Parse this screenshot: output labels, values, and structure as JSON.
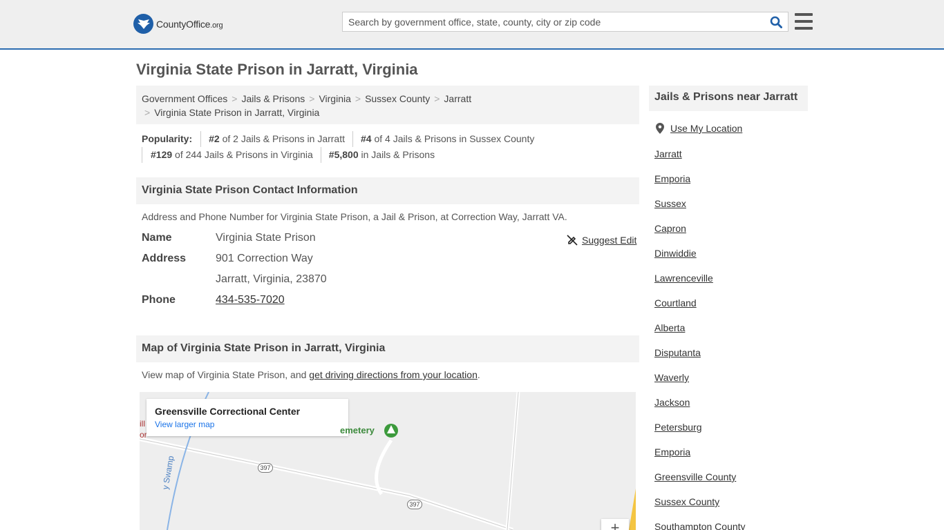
{
  "header": {
    "logo_name": "CountyOffice",
    "logo_tld": ".org",
    "search_placeholder": "Search by government office, state, county, city or zip code"
  },
  "page_title": "Virginia State Prison in Jarratt, Virginia",
  "breadcrumb": [
    "Government Offices",
    "Jails & Prisons",
    "Virginia",
    "Sussex County",
    "Jarratt",
    "Virginia State Prison in Jarratt, Virginia"
  ],
  "popularity": {
    "label": "Popularity:",
    "items": [
      {
        "rank": "#2",
        "text": " of 2 Jails & Prisons in Jarratt"
      },
      {
        "rank": "#4",
        "text": " of 4 Jails & Prisons in Sussex County"
      },
      {
        "rank": "#129",
        "text": " of 244 Jails & Prisons in Virginia"
      },
      {
        "rank": "#5,800",
        "text": " in Jails & Prisons"
      }
    ]
  },
  "contact": {
    "heading": "Virginia State Prison Contact Information",
    "description": "Address and Phone Number for Virginia State Prison, a Jail & Prison, at Correction Way, Jarratt VA.",
    "name_label": "Name",
    "name_value": "Virginia State Prison",
    "address_label": "Address",
    "address_line1": "901 Correction Way",
    "address_line2": "Jarratt, Virginia, 23870",
    "phone_label": "Phone",
    "phone_value": "434-535-7020",
    "suggest_edit": "Suggest Edit"
  },
  "map": {
    "heading": "Map of Virginia State Prison in Jarratt, Virginia",
    "desc_prefix": "View map of Virginia State Prison, and ",
    "desc_link": "get driving directions from your location",
    "desc_suffix": ".",
    "card_title": "Greensville Correctional Center",
    "card_link": "View larger map",
    "cemetery_label": "emetery",
    "route_1": "397",
    "route_2": "397",
    "stream_label": "y Swamp",
    "edge_label_1": "ill",
    "edge_label_2": "or",
    "zoom_in": "+"
  },
  "sidebar": {
    "heading": "Jails & Prisons near Jarratt",
    "use_location": "Use My Location",
    "items": [
      "Jarratt",
      "Emporia",
      "Sussex",
      "Capron",
      "Dinwiddie",
      "Lawrenceville",
      "Courtland",
      "Alberta",
      "Disputanta",
      "Waverly",
      "Jackson",
      "Petersburg",
      "Emporia",
      "Greensville County",
      "Sussex County",
      "Southampton County"
    ]
  }
}
